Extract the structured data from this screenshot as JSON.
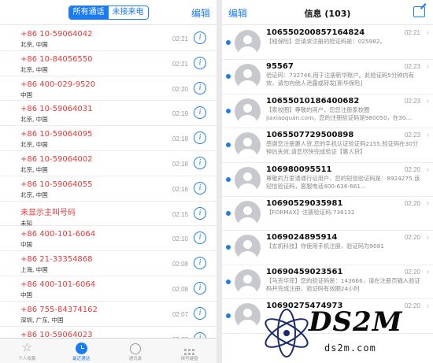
{
  "calls": {
    "tabs": [
      "所有通话",
      "未接来电"
    ],
    "edit_label": "编辑",
    "info_glyph": "i",
    "items": [
      {
        "number": "+86 10-59064042",
        "location": "北京, 中国",
        "time": "02:21"
      },
      {
        "number": "+86 10-84056550",
        "location": "北京, 中国",
        "time": "02:21"
      },
      {
        "number": "+86 400-029-9520",
        "location": "中国",
        "time": "02:20"
      },
      {
        "number": "+86 10-59064031",
        "location": "北京, 中国",
        "time": "02:19"
      },
      {
        "number": "+86 10-59064095",
        "location": "北京, 中国",
        "time": "02:18"
      },
      {
        "number": "+86 10-59064002",
        "location": "北京, 中国",
        "time": "02:18"
      },
      {
        "number": "+86 10-59064055",
        "location": "北京, 中国",
        "time": "02:16"
      },
      {
        "number": "未显示主叫号码",
        "location": "未知",
        "time": "02:15"
      },
      {
        "number": "+86 400-101-6064",
        "location": "中国",
        "time": "02:10"
      },
      {
        "number": "+86 21-33354868",
        "location": "上海, 中国",
        "time": "02:08"
      },
      {
        "number": "+86 400-101-6064",
        "location": "中国",
        "time": "02:08"
      },
      {
        "number": "+86 755-84374162",
        "location": "深圳, 广东, 中国",
        "time": "02:07"
      },
      {
        "number": "+86 10-59064023",
        "location": "",
        "time": "02:07"
      }
    ],
    "tabbar": [
      "个人收藏",
      "最近通话",
      "通讯录",
      "拨号键盘"
    ]
  },
  "messages": {
    "edit_label": "编辑",
    "title": "信息 (103)",
    "items": [
      {
        "sender": "10655020085716482​4",
        "time": "02:21",
        "preview": "【钱保险】您请求注册的验证码是：025982。"
      },
      {
        "sender": "95567",
        "time": "02:23",
        "preview": "验证码：732746,用于注册新华账户。此验证码5分钟内有效，请勿向他人泄露或转发[新华保险]"
      },
      {
        "sender": "10655010186400682",
        "time": "02:23",
        "preview": "【家校圈】尊敬的用户，您您注册家校圈 jiaxiaoquan.com。您的注册验证码是980050，在30..."
      },
      {
        "sender": "1065507729500898",
        "time": "02:23",
        "preview": "感谢您注册惠人贷,您的手机认证验证码2155,验证码在30分钟后失效,请您尽快完成验证【惠人贷】"
      },
      {
        "sender": "106980095511",
        "time": "02:20",
        "preview": "尊敬的万里通通行证用户，您的短信验证码是：8924275,该短信验证码，客服电话400-636-661..."
      },
      {
        "sender": "10690529035981",
        "time": "02:20",
        "preview": "【FORMAX】注册验证码:736132"
      },
      {
        "sender": "1069024895914",
        "time": "02:20",
        "preview": "【玄机科技】你使用手机注册，验证码为9081"
      },
      {
        "sender": "10690459023561",
        "time": "02:20",
        "preview": "【马克华菲】您的验证码是：143666，请在注册页输入验证码并完成注册，验证码有效期24小时"
      },
      {
        "sender": "10690275474973",
        "time": "02:20",
        "preview": ""
      }
    ]
  },
  "watermark": {
    "logo_text": "DS2M",
    "url_text": "ds2m.com"
  }
}
